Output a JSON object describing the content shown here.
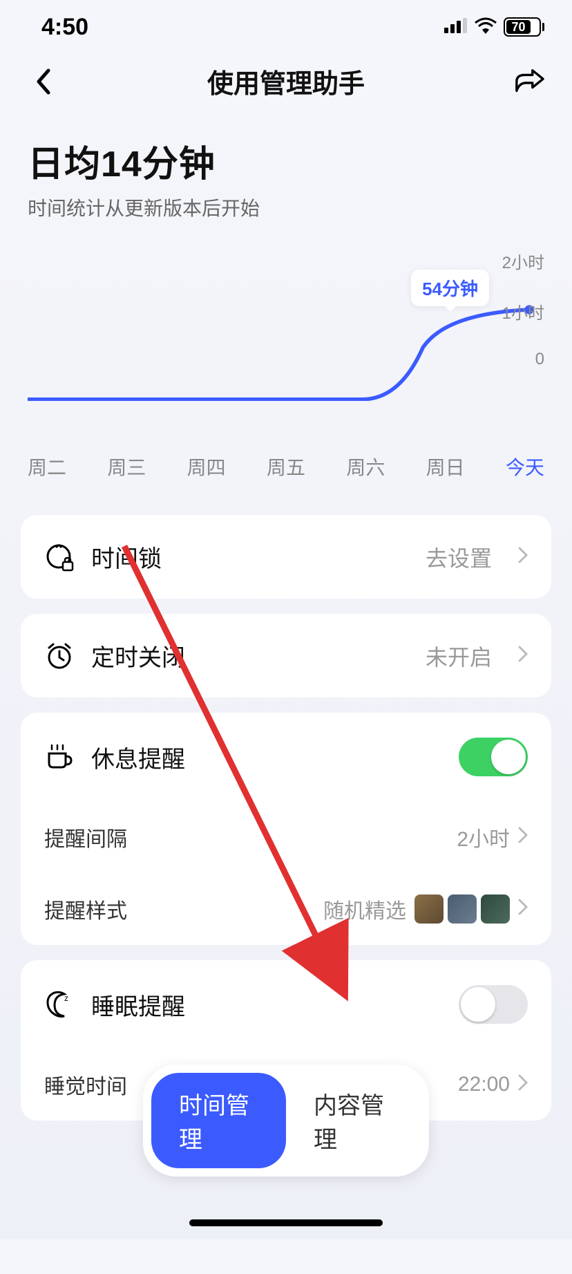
{
  "status": {
    "time": "4:50",
    "battery": "70"
  },
  "nav": {
    "title": "使用管理助手"
  },
  "summary": {
    "title": "日均14分钟",
    "subtitle": "时间统计从更新版本后开始"
  },
  "chart_data": {
    "type": "line",
    "categories": [
      "周二",
      "周三",
      "周四",
      "周五",
      "周六",
      "周日",
      "今天"
    ],
    "values": [
      0,
      0,
      0,
      0,
      0,
      50,
      54
    ],
    "ylim": [
      0,
      120
    ],
    "ylabel_unit": "分钟",
    "y_ticks": [
      "2小时",
      "1小时",
      "0"
    ],
    "highlight_index": 6,
    "tooltip": "54分钟"
  },
  "settings": {
    "time_lock": {
      "label": "时间锁",
      "value": "去设置"
    },
    "scheduled_off": {
      "label": "定时关闭",
      "value": "未开启"
    },
    "rest_reminder": {
      "label": "休息提醒",
      "on": true
    },
    "reminder_interval": {
      "label": "提醒间隔",
      "value": "2小时"
    },
    "reminder_style": {
      "label": "提醒样式",
      "value": "随机精选"
    },
    "sleep_reminder": {
      "label": "睡眠提醒",
      "on": false
    },
    "sleep_time": {
      "label": "睡觉时间",
      "value": "22:00"
    }
  },
  "tabs": {
    "time": "时间管理",
    "content": "内容管理"
  }
}
